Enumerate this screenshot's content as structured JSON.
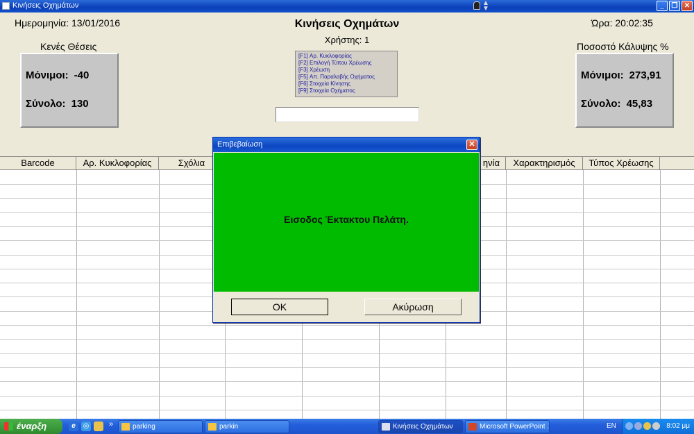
{
  "window": {
    "title": "Κινήσεις Οχημάτων",
    "minimize_label": "_",
    "maximize_label": "❐",
    "close_label": "✕"
  },
  "header": {
    "date_label": "Ημερομηνία: 13/01/2016",
    "title": "Κινήσεις Οχημάτων",
    "user_label": "Χρήστης: 1",
    "time_label": "Ώρα: 20:02:35"
  },
  "free_spaces": {
    "heading": "Κενές Θέσεις",
    "permanent_label": "Μόνιμοι:",
    "permanent_value": "-40",
    "total_label": "Σύνολο:",
    "total_value": "130"
  },
  "coverage": {
    "heading": "Ποσοστό Κάλυψης %",
    "permanent_label": "Μόνιμοι:",
    "permanent_value": "273,91",
    "total_label": "Σύνολο:",
    "total_value": "45,83"
  },
  "shortcuts": [
    "[F1]  Αρ. Κυκλοφορίας",
    "[F2]  Επιλογή Τύπου Χρέωσης",
    "[F3]  Χρέωση",
    "[F5]  Απ. Παραλαβής Οχήματος",
    "[F6]  Στοιχεία Κίνησης",
    "[F9]  Στοιχεία Οχήματος"
  ],
  "grid": {
    "columns": [
      "Barcode",
      "Αρ. Κυκλοφορίας",
      "Σχόλια",
      "",
      "",
      "",
      "ηνία",
      "Χαρακτηρισμός",
      "Τύπος Χρέωσης"
    ]
  },
  "dialog": {
    "title": "Επιβεβαίωση",
    "close_label": "✕",
    "message": "Εισοδος Έκτακτου Πελάτη.",
    "ok_label": "OK",
    "cancel_label": "Ακύρωση",
    "body_color": "#00bb00"
  },
  "taskbar": {
    "start_label": "έναρξη",
    "chevron": "»",
    "tasks": [
      {
        "label": "parking"
      },
      {
        "label": "parkin"
      },
      {
        "label": "Κινήσεις Οχημάτων"
      },
      {
        "label": "Microsoft PowerPoint ..."
      }
    ],
    "language": "EN",
    "clock": "8:02 μμ"
  }
}
